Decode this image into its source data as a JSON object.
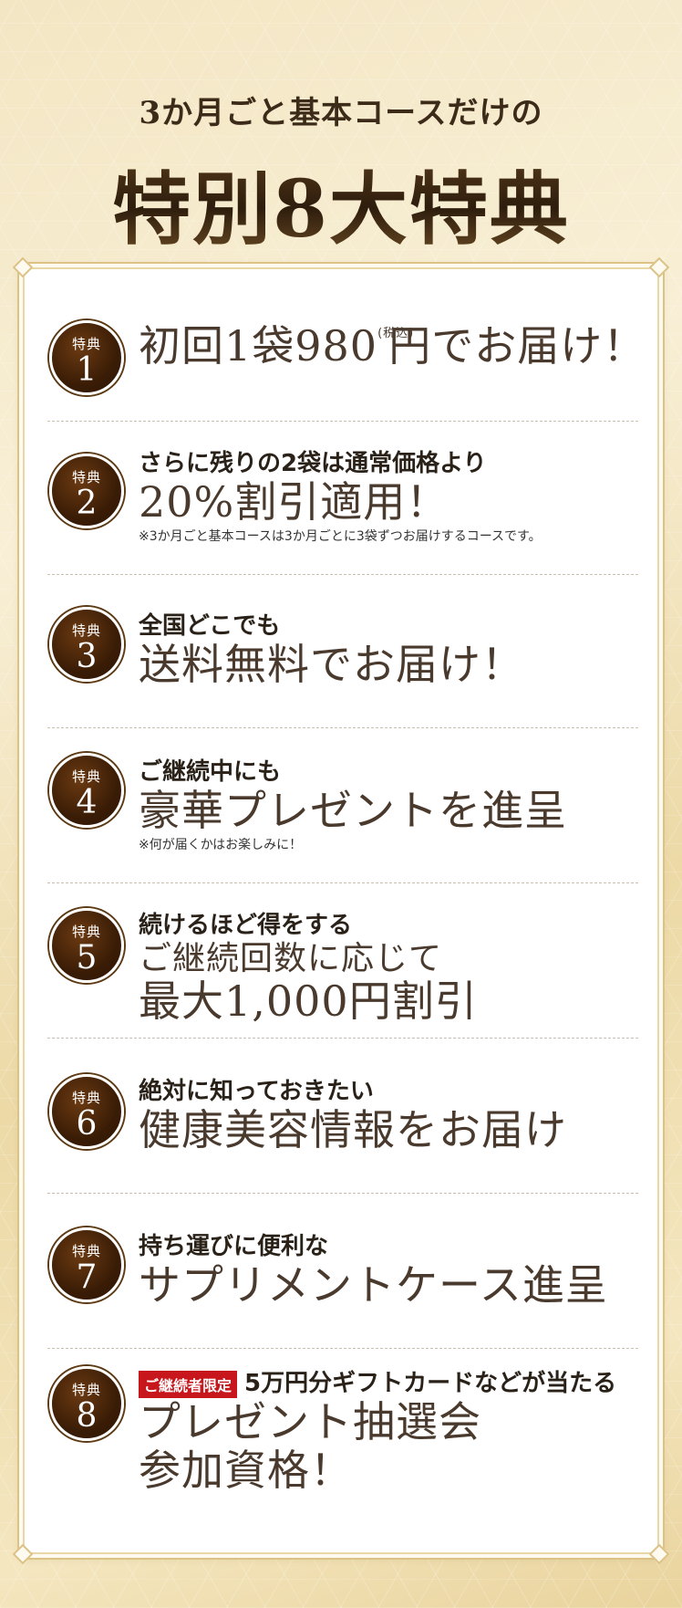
{
  "header": {
    "subtitle": "3か月ごと基本コースだけの",
    "title": "特別8大特典"
  },
  "badge_label": "特典",
  "items": [
    {
      "num": "1",
      "big": "初回1袋980",
      "tax": "(税込)",
      "big_suffix": "円でお届け！"
    },
    {
      "num": "2",
      "small": "さらに残りの2袋は通常価格より",
      "big": "20%割引適用！",
      "note": "※3か月ごと基本コースは3か月ごとに3袋ずつお届けするコースです。"
    },
    {
      "num": "3",
      "small": "全国どこでも",
      "big": "送料無料でお届け！"
    },
    {
      "num": "4",
      "small": "ご継続中にも",
      "big": "豪華プレゼントを進呈",
      "note": "※何が届くかはお楽しみに！"
    },
    {
      "num": "5",
      "small": "続けるほど得をする",
      "mid": "ご継続回数に応じて",
      "big": "最大1,000円割引"
    },
    {
      "num": "6",
      "small": "絶対に知っておきたい",
      "big": "健康美容情報をお届け"
    },
    {
      "num": "7",
      "small": "持ち運びに便利な",
      "big": "サプリメントケース進呈"
    },
    {
      "num": "8",
      "tag": "ご継続者限定",
      "small": "5万円分ギフトカードなどが当たる",
      "big": "プレゼント抽選会",
      "big2": "参加資格！"
    }
  ]
}
